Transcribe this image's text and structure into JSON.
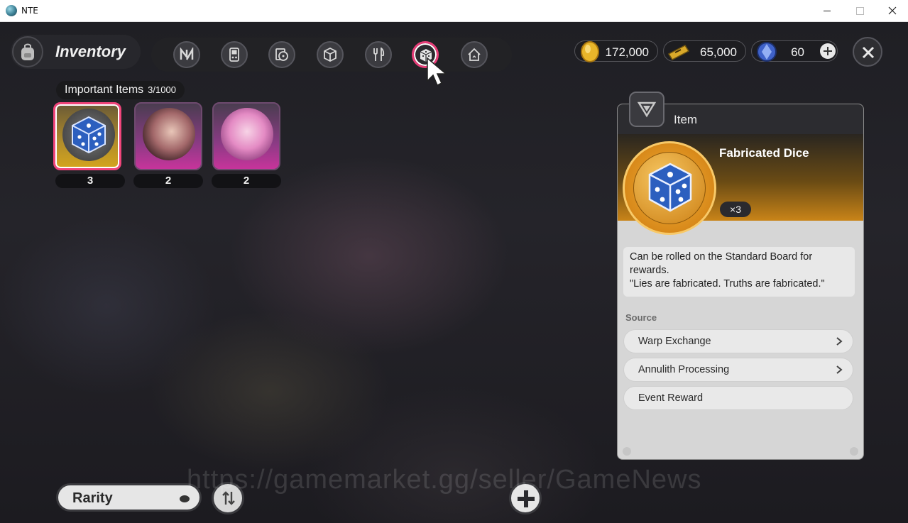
{
  "window": {
    "title": "NTE"
  },
  "header": {
    "title": "Inventory"
  },
  "tabs": [
    {
      "icon": "n-logo-icon"
    },
    {
      "icon": "handheld-console-icon"
    },
    {
      "icon": "disc-player-icon"
    },
    {
      "icon": "cube-icon"
    },
    {
      "icon": "fork-knife-icon"
    },
    {
      "icon": "dice-icon",
      "active": true
    },
    {
      "icon": "house-icon"
    }
  ],
  "currencies": [
    {
      "icon": "gold-coin-icon",
      "value": "172,000"
    },
    {
      "icon": "gold-ticket-icon",
      "value": "65,000"
    },
    {
      "icon": "blue-crystal-icon",
      "value": "60"
    }
  ],
  "section": {
    "label": "Important Items",
    "count": "3/1000"
  },
  "items": [
    {
      "name": "Fabricated Dice",
      "count": "3",
      "rarity": "gold",
      "selected": true
    },
    {
      "name": "character portrait",
      "count": "2",
      "rarity": "pink"
    },
    {
      "name": "character portrait",
      "count": "2",
      "rarity": "pink"
    }
  ],
  "detail": {
    "type": "Item",
    "name": "Fabricated Dice",
    "quantity": "×3",
    "description_line1": "Can be rolled on the Standard Board for",
    "description_line2": "rewards.",
    "description_line3": "\"Lies are fabricated. Truths are fabricated.\"",
    "source_label": "Source",
    "sources": [
      {
        "label": "Warp Exchange",
        "has_arrow": true
      },
      {
        "label": "Annulith Processing",
        "has_arrow": true
      },
      {
        "label": "Event Reward",
        "has_arrow": false
      }
    ]
  },
  "sort": {
    "label": "Rarity"
  },
  "watermark": "https://gamemarket.gg/seller/GameNews",
  "colors": {
    "accent": "#e73d78",
    "gold": "#d4a41d",
    "pink": "#c7349b"
  }
}
